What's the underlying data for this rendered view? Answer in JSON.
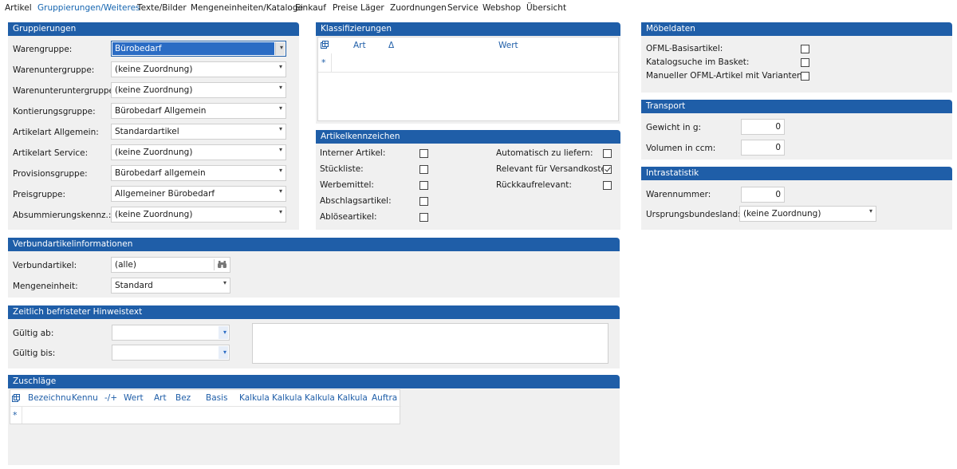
{
  "menu": [
    "Artikel",
    "Gruppierungen/Weiteres",
    "Texte/Bilder",
    "Mengeneinheiten/Kataloge",
    "Einkauf",
    "Preise",
    "Läger",
    "Zuordnungen",
    "Service",
    "Webshop",
    "Übersicht"
  ],
  "gruppierungen": {
    "title": "Gruppierungen",
    "rows": [
      {
        "label": "Warengruppe:",
        "value": "Bürobedarf"
      },
      {
        "label": "Warenuntergruppe:",
        "value": "(keine Zuordnung)"
      },
      {
        "label": "Warenunteruntergruppe:",
        "value": "(keine Zuordnung)"
      },
      {
        "label": "Kontierungsgruppe:",
        "value": "Bürobedarf Allgemein"
      },
      {
        "label": "Artikelart Allgemein:",
        "value": "Standardartikel"
      },
      {
        "label": "Artikelart Service:",
        "value": "(keine Zuordnung)"
      },
      {
        "label": "Provisionsgruppe:",
        "value": "Bürobedarf allgemein"
      },
      {
        "label": "Preisgruppe:",
        "value": "Allgemeiner Bürobedarf"
      },
      {
        "label": "Absummierungskennz.:",
        "value": "(keine Zuordnung)"
      }
    ]
  },
  "klassifizierungen": {
    "title": "Klassifizierungen",
    "columns": {
      "art": "Art",
      "sort": "Δ",
      "wert": "Wert"
    },
    "new_row": "*"
  },
  "artikelkennzeichen": {
    "title": "Artikelkennzeichen",
    "left": [
      {
        "label": "Interner Artikel:",
        "checked": false
      },
      {
        "label": "Stückliste:",
        "checked": false
      },
      {
        "label": "Werbemittel:",
        "checked": false
      },
      {
        "label": "Abschlagsartikel:",
        "checked": false
      },
      {
        "label": "Ablöseartikel:",
        "checked": false
      }
    ],
    "right": [
      {
        "label": "Automatisch zu liefern:",
        "checked": false
      },
      {
        "label": "Relevant für Versandkosten",
        "checked": true
      },
      {
        "label": "Rückkaufrelevant:",
        "checked": false
      }
    ]
  },
  "moebeldaten": {
    "title": "Möbeldaten",
    "rows": [
      {
        "label": "OFML-Basisartikel:",
        "checked": false
      },
      {
        "label": "Katalogsuche im Basket:",
        "checked": false
      },
      {
        "label": "Manueller OFML-Artikel mit Varianten:",
        "checked": false
      }
    ]
  },
  "transport": {
    "title": "Transport",
    "rows": [
      {
        "label": "Gewicht in g:",
        "value": "0"
      },
      {
        "label": "Volumen in ccm:",
        "value": "0"
      }
    ]
  },
  "intrastatistik": {
    "title": "Intrastatistik",
    "warennummer_label": "Warennummer:",
    "warennummer_value": "0",
    "ursprung_label": "Ursprungsbundesland:",
    "ursprung_value": "(keine Zuordnung)"
  },
  "verbund": {
    "title": "Verbundartikelinformationen",
    "verbundartikel_label": "Verbundartikel:",
    "verbundartikel_value": "(alle)",
    "mengeneinheit_label": "Mengeneinheit:",
    "mengeneinheit_value": "Standard"
  },
  "hinweis": {
    "title": "Zeitlich befristeter Hinweistext",
    "gueltig_ab_label": "Gültig ab:",
    "gueltig_bis_label": "Gültig bis:"
  },
  "zuschlaege": {
    "title": "Zuschläge",
    "columns": [
      "Bezeichnu",
      "Kennu",
      "-/+",
      "Wert",
      "Art",
      "Bez",
      "Basis",
      "Kalkula",
      "Kalkula",
      "Kalkula",
      "Kalkula",
      "Auftra"
    ],
    "new_row": "*"
  },
  "colors": {
    "header": "#1f5ea8",
    "active_menu": "#1565b0",
    "panel_bg": "#f0f0f0"
  },
  "icons": {
    "grid": "grid-settings-icon",
    "binoculars": "binoculars-icon",
    "dropdown": "chevron-down-icon"
  }
}
